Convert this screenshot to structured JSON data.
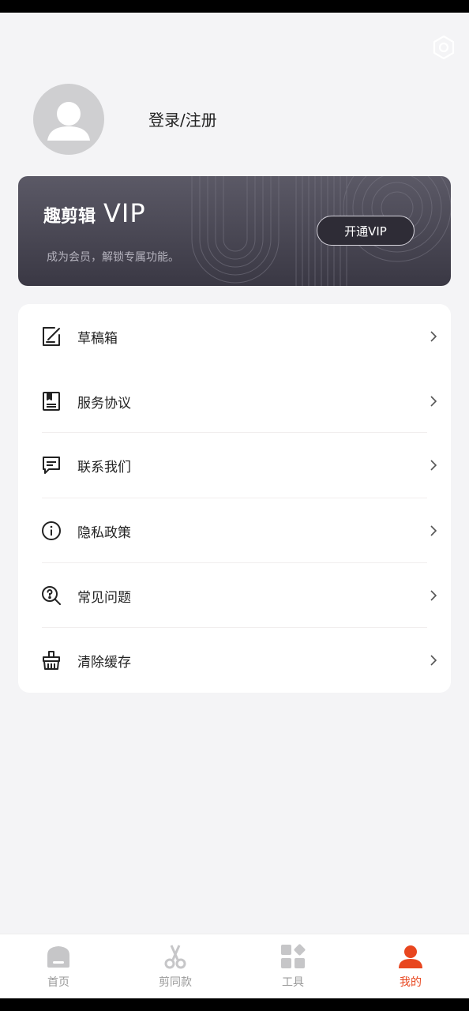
{
  "profile": {
    "login_label": "登录/注册"
  },
  "vip": {
    "brand": "趣剪辑",
    "title": "VIP",
    "subtitle": "成为会员，解锁专属功能。",
    "button": "开通VIP"
  },
  "menu": {
    "items": [
      {
        "label": "草稿箱",
        "icon": "draft-edit-icon"
      },
      {
        "label": "服务协议",
        "icon": "agreement-book-icon"
      },
      {
        "label": "联系我们",
        "icon": "message-icon"
      },
      {
        "label": "隐私政策",
        "icon": "info-icon"
      },
      {
        "label": "常见问题",
        "icon": "question-search-icon"
      },
      {
        "label": "清除缓存",
        "icon": "broom-basket-icon"
      }
    ]
  },
  "tabbar": {
    "tabs": [
      {
        "label": "首页",
        "icon": "home-icon"
      },
      {
        "label": "剪同款",
        "icon": "scissors-icon"
      },
      {
        "label": "工具",
        "icon": "tools-grid-icon"
      },
      {
        "label": "我的",
        "icon": "person-icon"
      }
    ],
    "active": "我的"
  },
  "colors": {
    "accent": "#e8461f",
    "vip_bg": "#3a3844",
    "page_bg": "#f4f4f6"
  }
}
